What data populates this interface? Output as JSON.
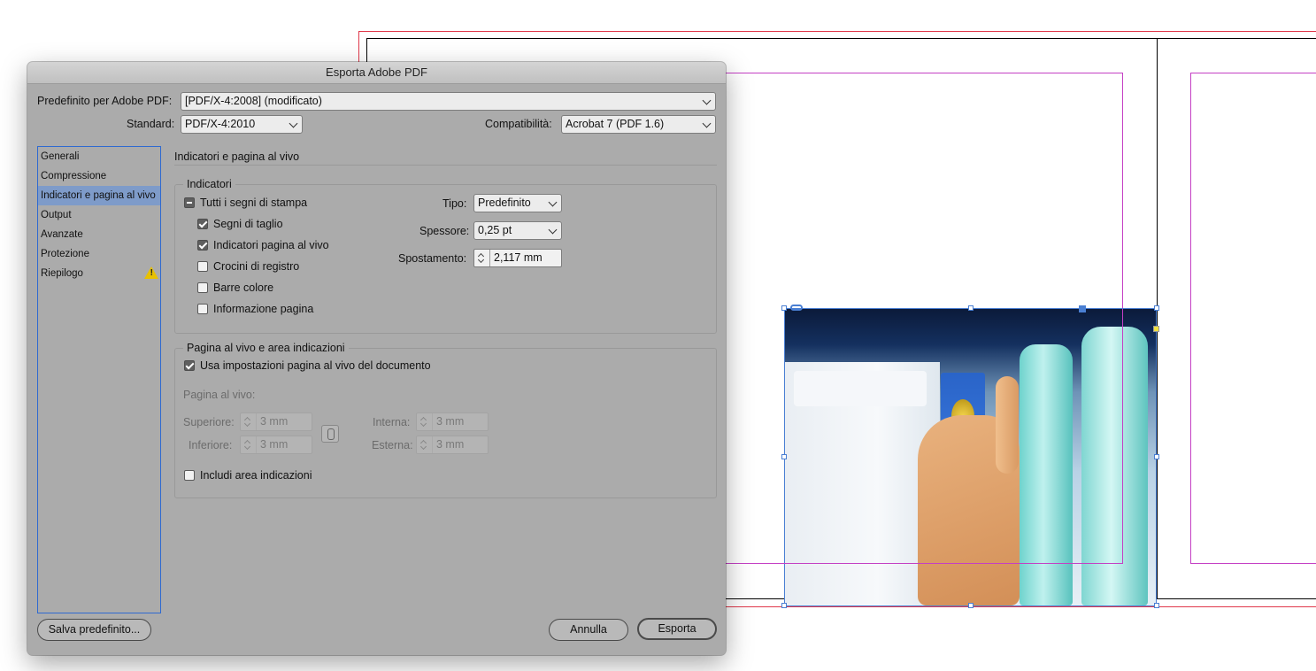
{
  "dialog": {
    "title": "Esporta Adobe PDF",
    "preset_label": "Predefinito per Adobe PDF:",
    "preset_value": "[PDF/X-4:2008] (modificato)",
    "standard_label": "Standard:",
    "standard_value": "PDF/X-4:2010",
    "compat_label": "Compatibilità:",
    "compat_value": "Acrobat 7 (PDF 1.6)"
  },
  "sidebar": {
    "items": [
      {
        "label": "Generali"
      },
      {
        "label": "Compressione"
      },
      {
        "label": "Indicatori e pagina al vivo"
      },
      {
        "label": "Output"
      },
      {
        "label": "Avanzate"
      },
      {
        "label": "Protezione"
      },
      {
        "label": "Riepilogo"
      }
    ],
    "selected_index": 2
  },
  "panel": {
    "title": "Indicatori e pagina al vivo",
    "marks_group": "Indicatori",
    "all_marks": "Tutti i segni di stampa",
    "crop_marks": "Segni di taglio",
    "bleed_marks": "Indicatori pagina al vivo",
    "registration": "Crocini di registro",
    "color_bars": "Barre colore",
    "page_info": "Informazione pagina",
    "type_label": "Tipo:",
    "type_value": "Predefinito",
    "weight_label": "Spessore:",
    "weight_value": "0,25 pt",
    "offset_label": "Spostamento:",
    "offset_value": "2,117 mm",
    "bleed_group": "Pagina al vivo e area indicazioni",
    "use_doc_bleed": "Usa impostazioni pagina al vivo del documento",
    "bleed_label": "Pagina al vivo:",
    "top_label": "Superiore:",
    "top_value": "3 mm",
    "bottom_label": "Inferiore:",
    "bottom_value": "3 mm",
    "inside_label": "Interna:",
    "inside_value": "3 mm",
    "outside_label": "Esterna:",
    "outside_value": "3 mm",
    "slug_area": "Includi area indicazioni"
  },
  "buttons": {
    "save_preset": "Salva predefinito...",
    "cancel": "Annulla",
    "export": "Esporta"
  },
  "colors": {
    "selection_blue": "#2f6ad0",
    "margin_magenta": "#c43fc4",
    "bleed_red": "#e0384a",
    "warning_yellow": "#e8c100"
  }
}
